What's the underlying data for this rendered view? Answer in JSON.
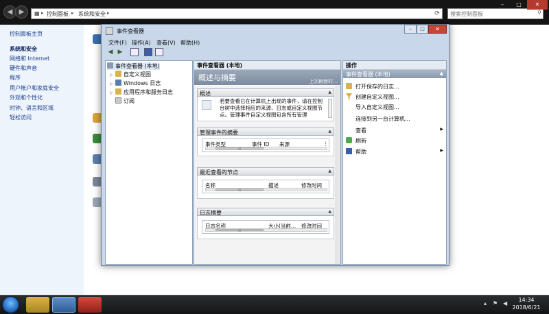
{
  "control_panel": {
    "breadcrumb": [
      "控制面板",
      "系统和安全"
    ],
    "search_placeholder": "搜索控制面板",
    "sidebar": {
      "home": "控制面板主页",
      "items": [
        "系统和安全",
        "网络和 Internet",
        "硬件和声音",
        "程序",
        "用户帐户和家庭安全",
        "外观和个性化",
        "时钟、语言和区域",
        "轻松访问"
      ]
    }
  },
  "event_viewer": {
    "title": "事件查看器",
    "menu": [
      "文件(F)",
      "操作(A)",
      "查看(V)",
      "帮助(H)"
    ],
    "tree": {
      "root": "事件查看器 (本地)",
      "items": [
        "自定义视图",
        "Windows 日志",
        "应用程序和服务日志",
        "订阅"
      ]
    },
    "middle": {
      "header": "事件查看器 (本地)",
      "banner_title": "概述与摘要",
      "banner_sub": "上次刷新时...",
      "overview": {
        "title": "概述",
        "text": "若要查看已在计算机上出现的事件，请在控制台树中选择相应的来源、日志或自定义视图节点。管理事件自定义视图包含所有管理"
      },
      "admin_events": {
        "title": "管理事件的摘要",
        "columns": [
          "事件类型",
          "事件 ID",
          "来源"
        ]
      },
      "recent_nodes": {
        "title": "最近查看的节点",
        "columns": [
          "名称",
          "描述",
          "修改时间"
        ]
      },
      "log_summary": {
        "title": "日志摘要",
        "columns": [
          "日志名称",
          "大小(当前...",
          "修改时间"
        ]
      },
      "scroll_thumb_label": "III"
    },
    "actions": {
      "header": "操作",
      "sub": "事件查看器 (本地)",
      "items": [
        "打开保存的日志...",
        "创建自定义视图...",
        "导入自定义视图...",
        "连接到另一台计算机...",
        "查看",
        "刷新",
        "帮助"
      ]
    }
  },
  "taskbar": {
    "time": "14:34",
    "date": "2018/6/21"
  }
}
